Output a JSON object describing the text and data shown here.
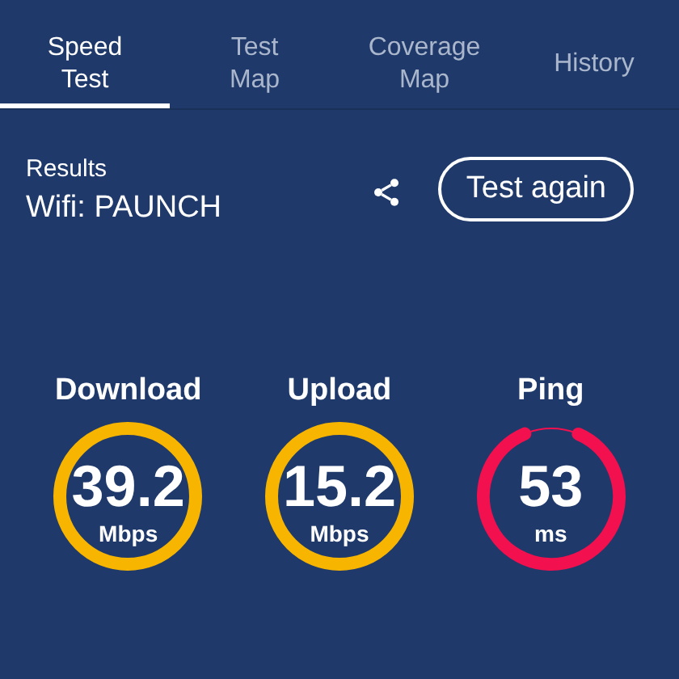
{
  "tabs": [
    {
      "label": "Speed\nTest",
      "selected": true
    },
    {
      "label": "Test\nMap",
      "selected": false
    },
    {
      "label": "Coverage\nMap",
      "selected": false
    },
    {
      "label": "History",
      "selected": false
    }
  ],
  "results": {
    "heading": "Results",
    "network": "Wifi: PAUNCH",
    "button": "Test again"
  },
  "gauges": [
    {
      "label": "Download",
      "value": "39.2",
      "unit": "Mbps",
      "kind": "closed",
      "color": "#f7b500"
    },
    {
      "label": "Upload",
      "value": "15.2",
      "unit": "Mbps",
      "kind": "closed",
      "color": "#f7b500"
    },
    {
      "label": "Ping",
      "value": "53",
      "unit": "ms",
      "kind": "open",
      "color": "#f2104f"
    }
  ]
}
